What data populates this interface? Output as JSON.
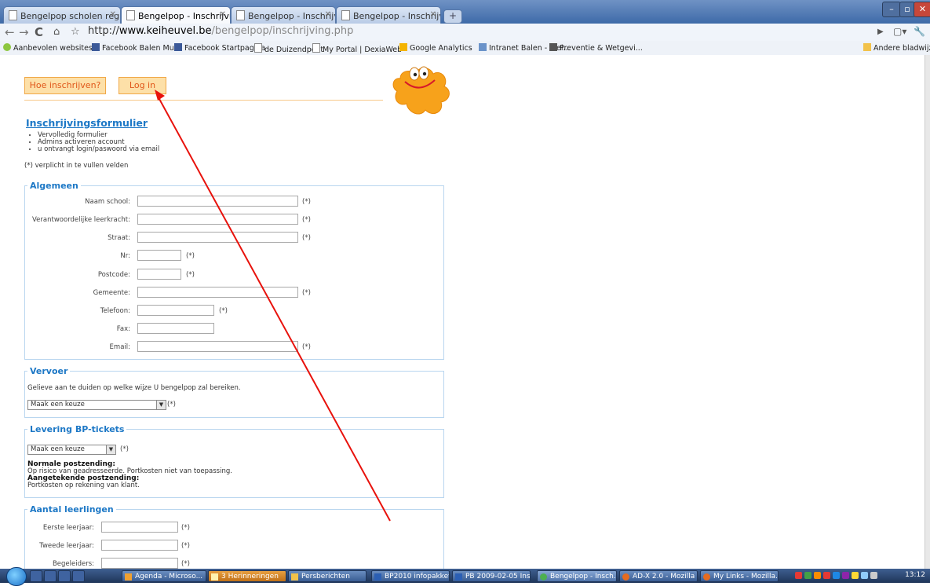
{
  "browser": {
    "tabs": [
      {
        "title": "Bengelpop scholen regist...",
        "active": false
      },
      {
        "title": "Bengelpop - Inschrijvingen",
        "active": true
      },
      {
        "title": "Bengelpop - Inschrijvingen",
        "active": false
      },
      {
        "title": "Bengelpop - Inschrijvingen",
        "active": false
      }
    ],
    "url_prefix": "http://",
    "url_domain": "www.keiheuvel.be",
    "url_path": "/bengelpop/inschrijving.php",
    "bookmarks": [
      "Aanbevolen websites",
      "Facebook Balen Mu...",
      "Facebook Startpagina",
      "de Duizendpoot",
      "My Portal | DexiaWeb",
      "Google Analytics",
      "Intranet Balen - Wel...",
      "Preventie & Wetgevi..."
    ],
    "other_bookmarks": "Andere bladwijzers"
  },
  "page": {
    "btn_howto": "Hoe inschrijven?",
    "btn_login": "Log in",
    "form_title": "Inschrijvingsformulier",
    "bullets": [
      "Vervolledig formulier",
      "Admins activeren account",
      "u ontvangt login/paswoord via email"
    ],
    "required_note": "(*) verplicht in te vullen velden",
    "required_mark": "(*)",
    "algemeen": {
      "legend": "Algemeen",
      "fields": [
        {
          "label": "Naam school:",
          "required": "(*)"
        },
        {
          "label": "Verantwoordelijke leerkracht:",
          "required": "(*)"
        },
        {
          "label": "Straat:",
          "required": "(*)"
        },
        {
          "label": "Nr:",
          "required": "(*)"
        },
        {
          "label": "Postcode:",
          "required": "(*)"
        },
        {
          "label": "Gemeente:",
          "required": "(*)"
        },
        {
          "label": "Telefoon:",
          "required": "(*)"
        },
        {
          "label": "Fax:",
          "required": ""
        },
        {
          "label": "Email:",
          "required": "(*)"
        }
      ]
    },
    "vervoer": {
      "legend": "Vervoer",
      "text": "Gelieve aan te duiden op welke wijze U bengelpop zal bereiken.",
      "select_value": "Maak een keuze"
    },
    "levering": {
      "legend": "Levering BP-tickets",
      "select_value": "Maak een keuze",
      "normal_title": "Normale postzending",
      "normal_text": "Op risico van geadresseerde. Portkosten niet van toepassing.",
      "registered_title": "Aangetekende postzending",
      "registered_text": "Portkosten op rekening van klant."
    },
    "leerlingen": {
      "legend": "Aantal leerlingen",
      "fields": [
        {
          "label": "Eerste leerjaar:",
          "required": "(*)"
        },
        {
          "label": "Tweede leerjaar:",
          "required": "(*)"
        },
        {
          "label": "Begeleiders:",
          "required": "(*)"
        }
      ]
    }
  },
  "taskbar": {
    "items": [
      "Agenda - Microso...",
      "3 Herinneringen",
      "Persberichten",
      "BP2010 infopakket...",
      "PB 2009-02-05 Ins...",
      "Bengelpop - Insch...",
      "AD-X 2.0 - Mozilla ...",
      "My Links - Mozilla..."
    ],
    "clock": "13:12"
  },
  "colors": {
    "accent_blue": "#1d78c6",
    "button_orange": "#e0571a",
    "button_bg": "#fde0a8",
    "arrow_red": "#e8120c",
    "mascot_orange": "#f7a21b"
  }
}
